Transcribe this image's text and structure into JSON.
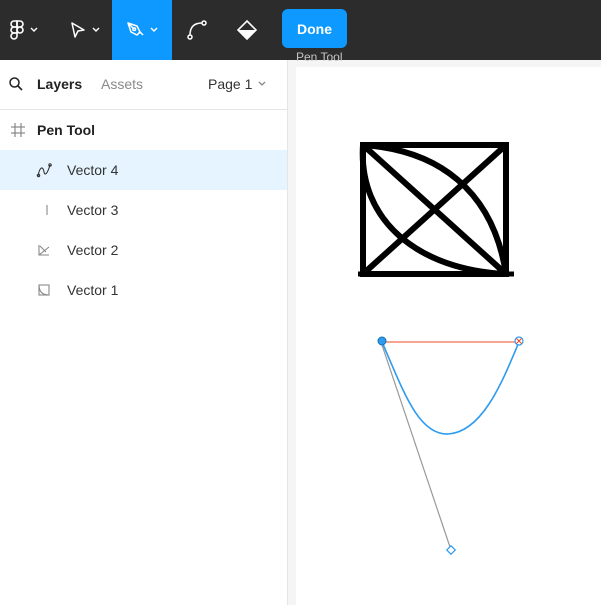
{
  "toolbar": {
    "done_label": "Done",
    "tools": [
      {
        "name": "main-menu",
        "icon": "figma-logo-icon"
      },
      {
        "name": "move",
        "icon": "cursor-arrow-icon"
      },
      {
        "name": "pen",
        "icon": "pen-icon",
        "active": true
      },
      {
        "name": "bend",
        "icon": "bend-tool-icon"
      },
      {
        "name": "paint-bucket",
        "icon": "paint-bucket-icon"
      }
    ]
  },
  "left_panel": {
    "tabs": {
      "layers": "Layers",
      "assets": "Assets"
    },
    "page_select": "Page 1",
    "frame_name": "Pen Tool",
    "layers": [
      {
        "label": "Vector 4",
        "icon": "vector-curve-icon",
        "selected": true
      },
      {
        "label": "Vector 3",
        "icon": "vector-line-icon",
        "selected": false
      },
      {
        "label": "Vector 2",
        "icon": "vector-angle-icon",
        "selected": false
      },
      {
        "label": "Vector 1",
        "icon": "vector-shape-icon",
        "selected": false
      }
    ]
  },
  "canvas": {
    "frame_title": "Pen Tool"
  },
  "colors": {
    "toolbar_bg": "#2c2c2c",
    "accent": "#0d99ff",
    "selection_bg": "#e5f4ff",
    "path_blue": "#2c9bf0",
    "handle_red": "#f24822"
  }
}
